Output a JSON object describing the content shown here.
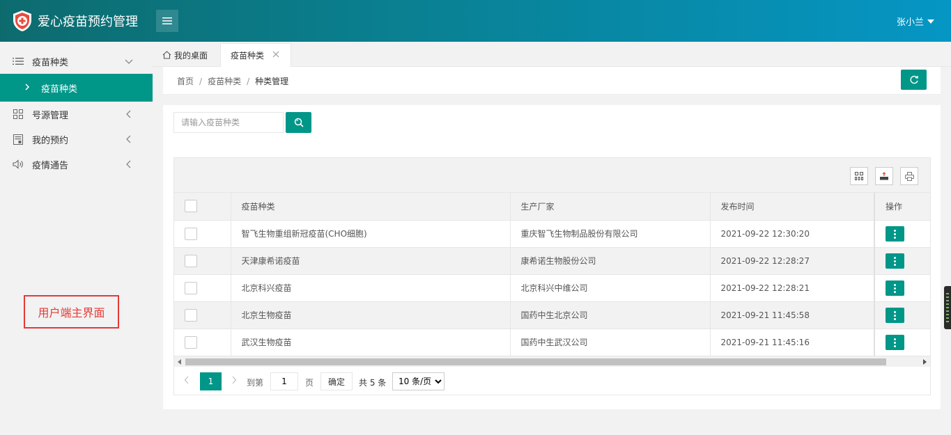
{
  "header": {
    "app_title": "爱心疫苗预约管理",
    "user_name": "张小兰",
    "accent": "#009688"
  },
  "sidebar": {
    "items": [
      {
        "label": "疫苗种类",
        "icon": "list-icon",
        "expanded": true
      },
      {
        "label": "号源管理",
        "icon": "grid-icon",
        "expanded": false
      },
      {
        "label": "我的预约",
        "icon": "calendar-icon",
        "expanded": false
      },
      {
        "label": "疫情通告",
        "icon": "speaker-icon",
        "expanded": false
      }
    ],
    "sub_item": {
      "label": "疫苗种类"
    },
    "annotation": "用户端主界面"
  },
  "tabs": {
    "home": "我的桌面",
    "active": "疫苗种类"
  },
  "breadcrumb": {
    "items": [
      "首页",
      "疫苗种类",
      "种类管理"
    ]
  },
  "search": {
    "placeholder": "请输入疫苗种类",
    "value": ""
  },
  "table": {
    "columns": [
      "疫苗种类",
      "生产厂家",
      "发布时间",
      "操作"
    ],
    "rows": [
      {
        "name": "智飞生物重组新冠疫苗(CHO细胞)",
        "maker": "重庆智飞生物制品股份有限公司",
        "time": "2021-09-22 12:30:20"
      },
      {
        "name": "天津康希诺疫苗",
        "maker": "康希诺生物股份公司",
        "time": "2021-09-22 12:28:27"
      },
      {
        "name": "北京科兴疫苗",
        "maker": "北京科兴中维公司",
        "time": "2021-09-22 12:28:21"
      },
      {
        "name": "北京生物疫苗",
        "maker": "国药中生北京公司",
        "time": "2021-09-21 11:45:58"
      },
      {
        "name": "武汉生物疫苗",
        "maker": "国药中生武汉公司",
        "time": "2021-09-21 11:45:16"
      }
    ]
  },
  "pager": {
    "current": "1",
    "goto_label": "到第",
    "goto_value": "1",
    "page_label": "页",
    "confirm_label": "确定",
    "total_label": "共 5 条",
    "page_size": "10 条/页"
  }
}
